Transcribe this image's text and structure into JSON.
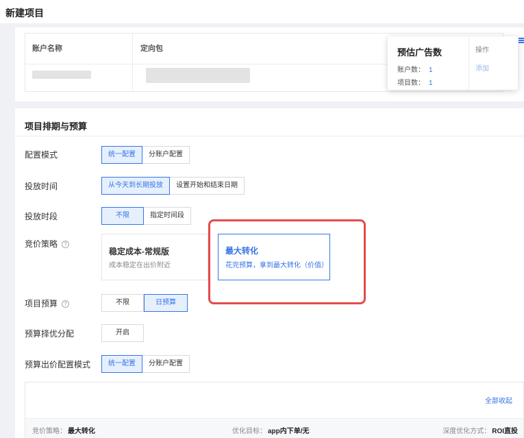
{
  "header": {
    "title": "新建项目"
  },
  "account_table": {
    "columns": [
      "账户名称",
      "定向包"
    ]
  },
  "popover": {
    "title": "预估广告数",
    "rows": [
      {
        "label": "账户数：",
        "value": "1"
      },
      {
        "label": "项目数：",
        "value": "1"
      }
    ],
    "op_header": "操作",
    "op_value": "添加"
  },
  "schedule": {
    "title": "项目排期与预算",
    "config_mode": {
      "label": "配置模式",
      "options": [
        "统一配置",
        "分账户配置"
      ],
      "selected": 0
    },
    "delivery_time": {
      "label": "投放时间",
      "options": [
        "从今天到长期投放",
        "设置开始和结束日期"
      ],
      "selected": 0
    },
    "delivery_period": {
      "label": "投放时段",
      "options": [
        "不限",
        "指定时间段"
      ],
      "selected": 0
    },
    "bid_strategy": {
      "label": "竞价策略",
      "help": "?",
      "cards": [
        {
          "name": "稳定成本-常规版",
          "desc": "成本稳定在出价附近"
        },
        {
          "name": "最大转化",
          "desc": "花完预算，拿到最大转化（价值）",
          "selected": true
        }
      ]
    },
    "project_budget": {
      "label": "项目预算",
      "help": "?",
      "options": [
        "不限",
        "日预算"
      ],
      "selected": 1
    },
    "budget_optimize": {
      "label": "预算择优分配",
      "button": "开启"
    },
    "bid_config_mode": {
      "label": "预算出价配置模式",
      "options": [
        "统一配置",
        "分账户配置"
      ],
      "selected": 0
    }
  },
  "summary_panel": {
    "collapse_all": "全部收起",
    "bid_strategy_label": "竞价策略：",
    "bid_strategy_value": "最大转化",
    "goal_label": "优化目标：",
    "goal_value": "app内下单/无",
    "deep_label": "深度优化方式：",
    "deep_value": "ROI直投"
  },
  "colors": {
    "accent": "#3574e6",
    "highlight": "#e44a4a"
  }
}
